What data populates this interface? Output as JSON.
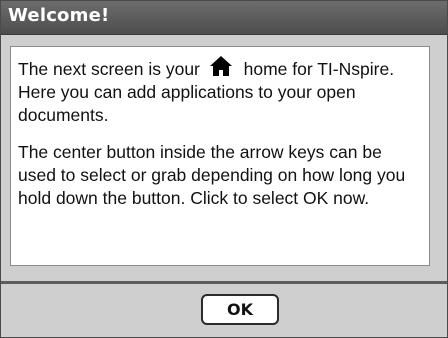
{
  "dialog": {
    "title": "Welcome!",
    "paragraph1": {
      "before_icon": "The next screen is your",
      "icon": "home-icon",
      "after_icon": "home for TI-Nspire.  Here you can add applications to your open documents."
    },
    "paragraph2": "The center button inside the arrow keys can be used to select or grab depending on how long you hold down the button. Click to select OK now.",
    "ok_label": "OK"
  },
  "colors": {
    "titlebar": "#5c5c5c",
    "dialog_background": "#cfcfcf",
    "content_background": "#ffffff",
    "text": "#111111"
  }
}
